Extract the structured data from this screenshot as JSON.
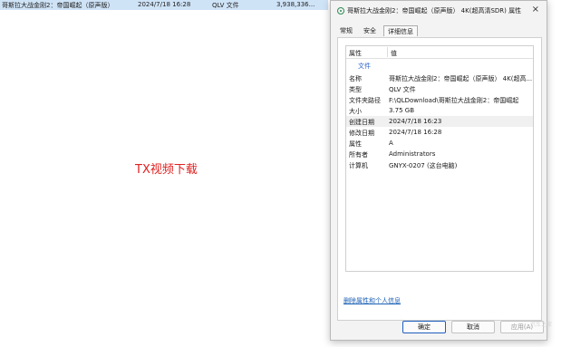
{
  "file_row": {
    "name": "哥斯拉大战金刚2：帝国崛起（原声版）",
    "date": "2024/7/18 16:28",
    "type": "QLV 文件",
    "size": "3,938,336..."
  },
  "caption": "TX视频下载",
  "dialog": {
    "title": "哥斯拉大战金刚2：帝国崛起（原声版） 4K(超高清SDR) 属性",
    "close_label": "×",
    "tabs": [
      "常规",
      "安全",
      "详细信息"
    ],
    "columns": {
      "property": "属性",
      "value": "值"
    },
    "group": "文件",
    "rows": [
      {
        "k": "名称",
        "v": "哥斯拉大战金刚2：帝国崛起（原声版） 4K(超高..."
      },
      {
        "k": "类型",
        "v": "QLV 文件"
      },
      {
        "k": "文件夹路径",
        "v": "F:\\QLDownload\\哥斯拉大战金刚2：帝国崛起"
      },
      {
        "k": "大小",
        "v": "3.75 GB"
      },
      {
        "k": "创建日期",
        "v": "2024/7/18 16:23"
      },
      {
        "k": "修改日期",
        "v": "2024/7/18 16:28"
      },
      {
        "k": "属性",
        "v": "A"
      },
      {
        "k": "所有者",
        "v": "Administrators"
      },
      {
        "k": "计算机",
        "v": "GNYX-0207 (这台电脑)"
      }
    ],
    "remove_link": "删除属性和个人信息",
    "buttons": {
      "ok": "确定",
      "cancel": "取消",
      "apply": "应用(A)"
    }
  },
  "watermark": "汽车之家"
}
